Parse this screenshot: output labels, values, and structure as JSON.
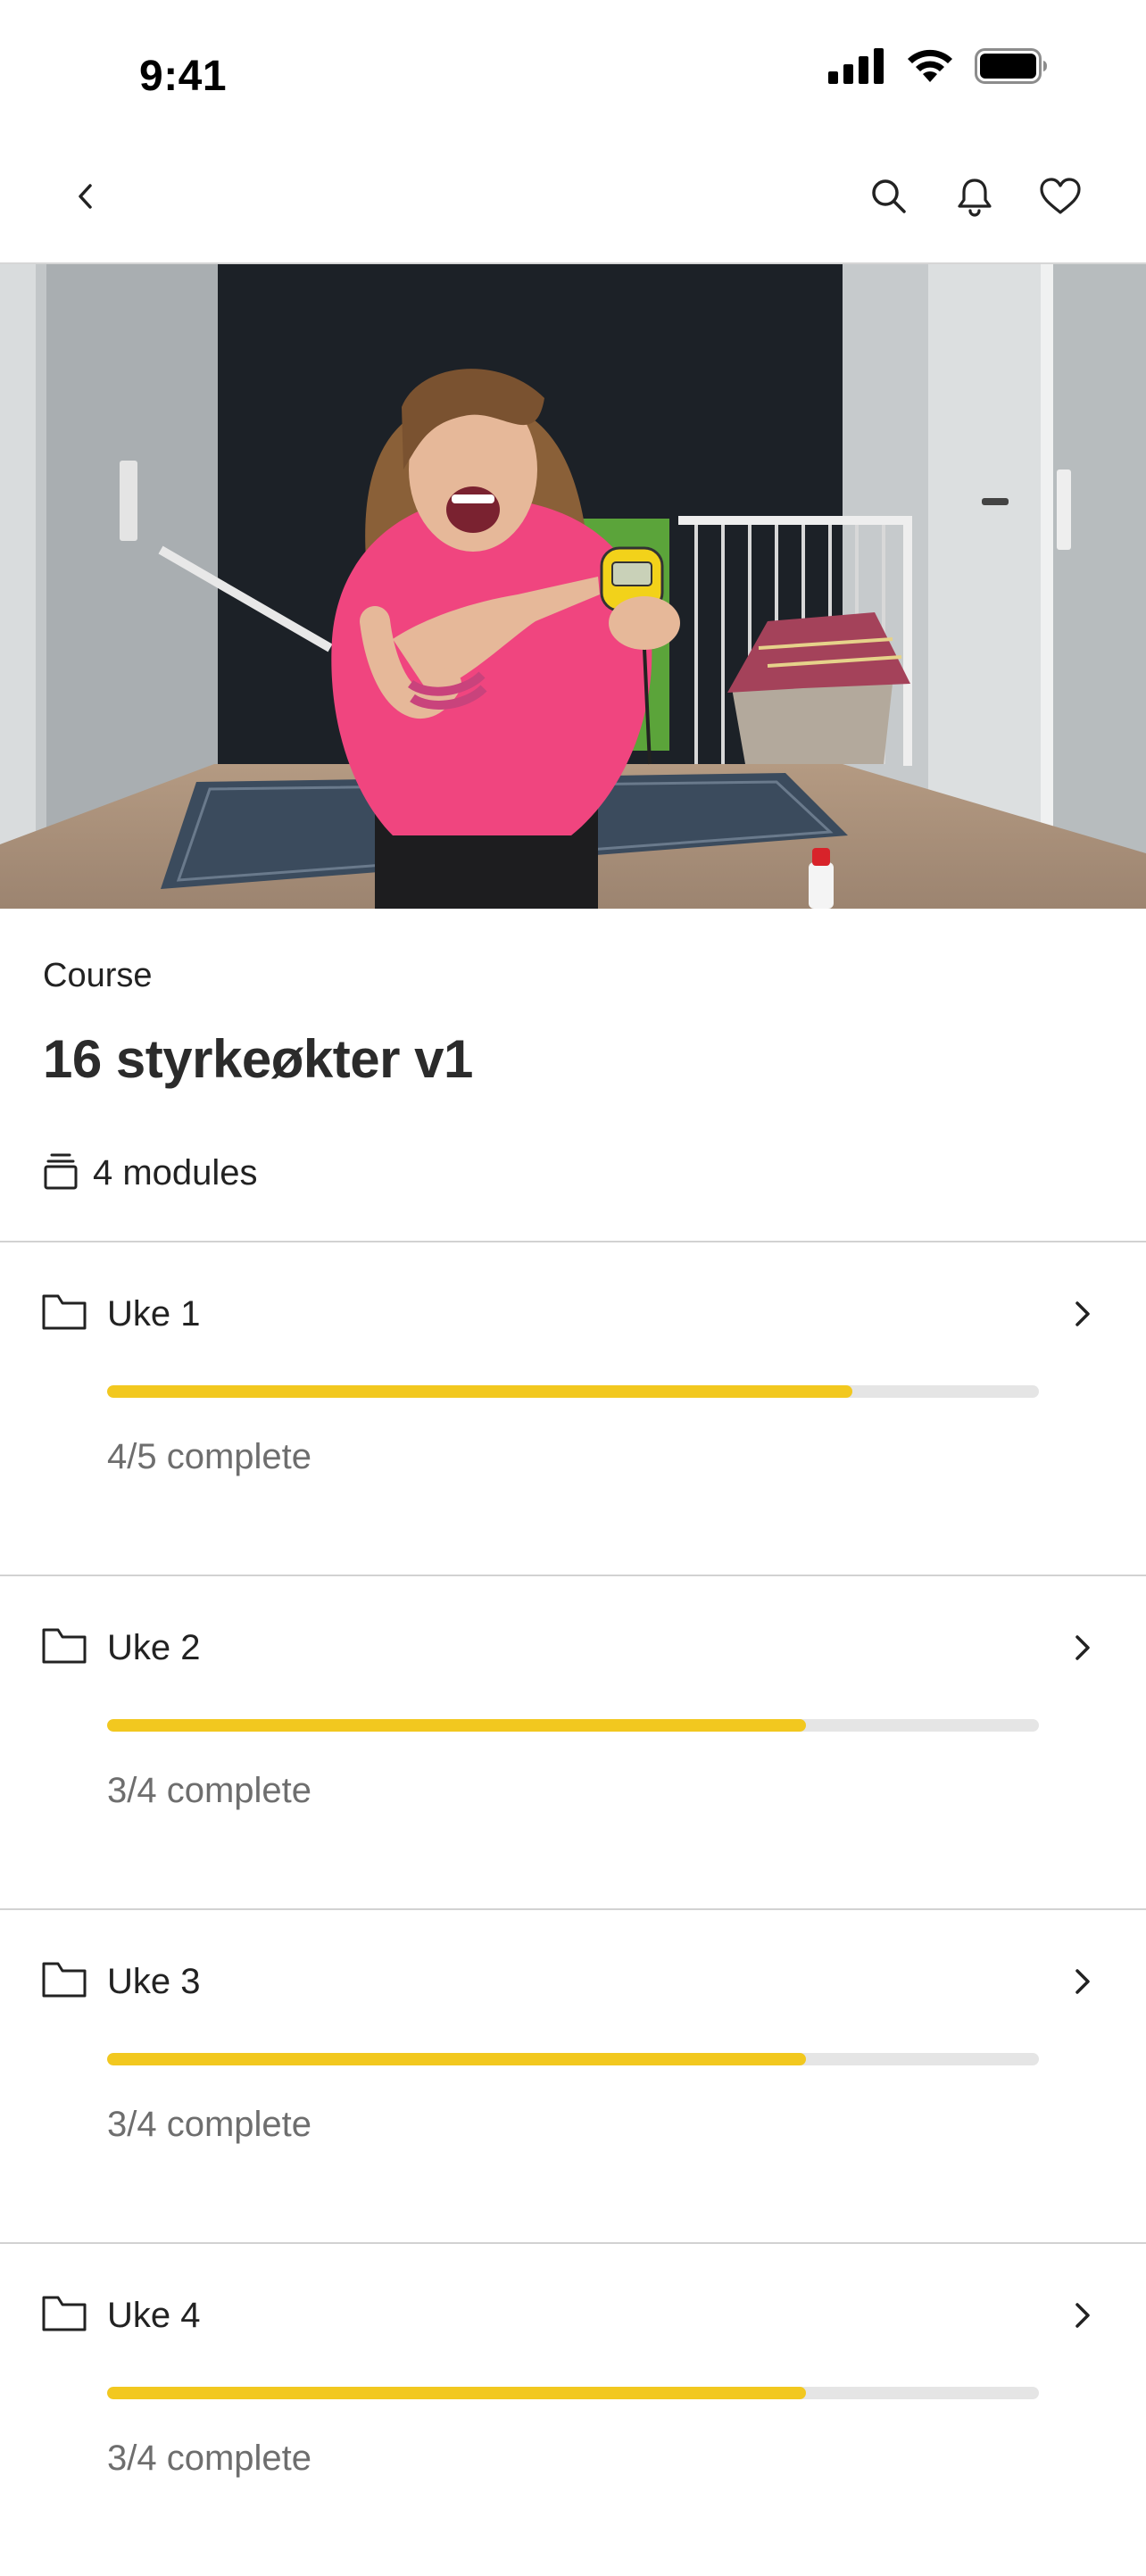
{
  "status_bar": {
    "time": "9:41"
  },
  "nav": {
    "icons": [
      "chevron-left-icon",
      "search-icon",
      "bell-icon",
      "heart-icon"
    ]
  },
  "hero": {
    "image": "instructor-holding-stopwatch-photo"
  },
  "course": {
    "kicker": "Course",
    "title": "16 styrkeøkter v1",
    "modules_text": "4 modules"
  },
  "colors": {
    "progress": "#f2c81f",
    "track": "#e5e5e5",
    "text": "#222222",
    "muted": "#6e6e6e"
  },
  "modules": [
    {
      "name": "Uke 1",
      "status": "4/5 complete",
      "progress": 0.8
    },
    {
      "name": "Uke 2",
      "status": "3/4 complete",
      "progress": 0.75
    },
    {
      "name": "Uke 3",
      "status": "3/4 complete",
      "progress": 0.75
    },
    {
      "name": "Uke 4",
      "status": "3/4 complete",
      "progress": 0.75
    }
  ]
}
